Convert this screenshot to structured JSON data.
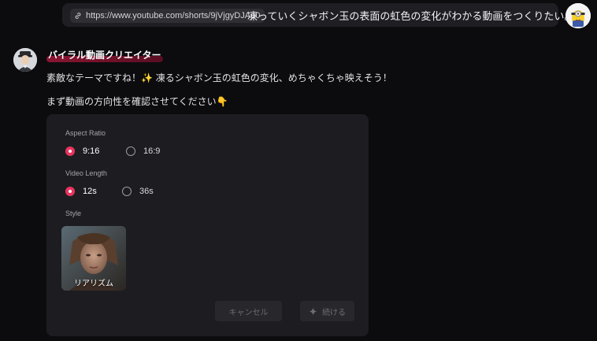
{
  "user_message": {
    "link_url": "https://www.youtube.com/shorts/9jVjgyDJAp0",
    "text": "凍っていくシャボン玉の表面の虹色の変化がわかる動画をつくりたい。"
  },
  "bot": {
    "name": "バイラル動画クリエイター",
    "message_1": "素敵なテーマですね！✨ 凍るシャボン玉の虹色の変化、めちゃくちゃ映えそう！",
    "message_2": "まず動画の方向性を確認させてください👇"
  },
  "form": {
    "aspect_ratio": {
      "label": "Aspect Ratio",
      "options": [
        "9:16",
        "16:9"
      ],
      "selected": "9:16"
    },
    "video_length": {
      "label": "Video Length",
      "options": [
        "12s",
        "36s"
      ],
      "selected": "12s"
    },
    "style": {
      "label": "Style",
      "options": [
        {
          "name": "リアリズム",
          "selected": true
        }
      ]
    },
    "buttons": {
      "cancel": "キャンセル",
      "continue": "続ける"
    }
  },
  "colors": {
    "accent": "#e8345e",
    "background": "#0c0c0f",
    "card": "#1d1d21"
  },
  "icons": [
    "link-icon",
    "sparkle-icon",
    "user-avatar",
    "bot-avatar"
  ]
}
